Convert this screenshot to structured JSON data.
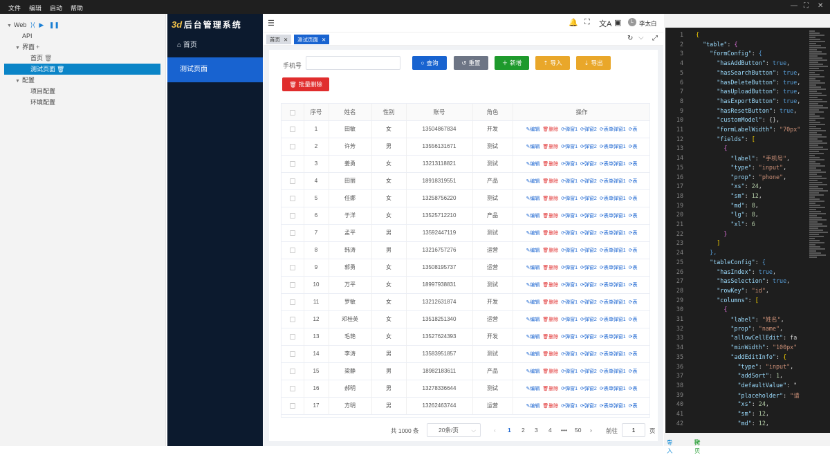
{
  "menubar": {
    "items": [
      "文件",
      "编辑",
      "启动",
      "帮助"
    ]
  },
  "tree": {
    "root": "Web",
    "api": "API",
    "ui": "界面",
    "home": "首页",
    "testpage": "测试页面",
    "config": "配置",
    "project_cfg": "项目配置",
    "env_cfg": "环境配置"
  },
  "app": {
    "logo_mark": "3d",
    "title": "后台管理系统",
    "nav": [
      "首页",
      "测试页面"
    ]
  },
  "header": {
    "user": "李太白",
    "user_initial": "L"
  },
  "tabs": [
    {
      "label": "首页"
    },
    {
      "label": "测试页面"
    }
  ],
  "form": {
    "phone_label": "手机号",
    "phone_value": "",
    "buttons": {
      "search": "查询",
      "reset": "重置",
      "add": "新增",
      "import": "导入",
      "export": "导出",
      "batch_delete": "批量删除"
    }
  },
  "colors": {
    "primary": "#1863d0",
    "gray": "#6d7585",
    "success": "#1e9a2c",
    "warning": "#e9a72a",
    "danger": "#e02d2d",
    "editor_bg": "#1e1e1e"
  },
  "table": {
    "columns": [
      "序号",
      "姓名",
      "性别",
      "账号",
      "角色",
      "操作"
    ],
    "actions": [
      "编辑",
      "删除",
      "弹窗1",
      "弹窗2",
      "表单弹窗1",
      "表"
    ],
    "rows": [
      [
        "1",
        "田敏",
        "女",
        "13504867834",
        "开发"
      ],
      [
        "2",
        "许芳",
        "男",
        "13556131671",
        "测试"
      ],
      [
        "3",
        "姜勇",
        "女",
        "13213118821",
        "测试"
      ],
      [
        "4",
        "田丽",
        "女",
        "18918319551",
        "产品"
      ],
      [
        "5",
        "任娜",
        "女",
        "13258756220",
        "测试"
      ],
      [
        "6",
        "于洋",
        "女",
        "13525712210",
        "产品"
      ],
      [
        "7",
        "孟平",
        "男",
        "13592447119",
        "测试"
      ],
      [
        "8",
        "韩涛",
        "男",
        "13216757276",
        "运营"
      ],
      [
        "9",
        "郭勇",
        "女",
        "13508195737",
        "运营"
      ],
      [
        "10",
        "万平",
        "女",
        "18997938831",
        "测试"
      ],
      [
        "11",
        "罗敏",
        "女",
        "13212631874",
        "开发"
      ],
      [
        "12",
        "邓桂英",
        "女",
        "13518251340",
        "运营"
      ],
      [
        "13",
        "毛艳",
        "女",
        "13527624393",
        "开发"
      ],
      [
        "14",
        "李涛",
        "男",
        "13583951857",
        "测试"
      ],
      [
        "15",
        "梁静",
        "男",
        "18982183611",
        "产品"
      ],
      [
        "16",
        "郝明",
        "男",
        "13278336644",
        "测试"
      ],
      [
        "17",
        "方明",
        "男",
        "13262463744",
        "运营"
      ]
    ]
  },
  "pagination": {
    "total": "共 1000 条",
    "page_size": "20条/页",
    "pages": [
      "1",
      "2",
      "3",
      "4",
      "•••",
      "50"
    ],
    "goto_label": "前往",
    "goto_value": "1",
    "page_unit": "页"
  },
  "editor": {
    "lines": [
      {
        "n": "1",
        "t": [
          [
            "p",
            "{"
          ]
        ]
      },
      {
        "n": "2",
        "t": [
          [
            "",
            "  "
          ],
          [
            "k",
            "\"table\""
          ],
          [
            "",
            ": "
          ],
          [
            "q",
            "{"
          ]
        ]
      },
      {
        "n": "3",
        "t": [
          [
            "",
            "    "
          ],
          [
            "k",
            "\"formConfig\""
          ],
          [
            "",
            ": "
          ],
          [
            "b",
            "{"
          ]
        ]
      },
      {
        "n": "4",
        "t": [
          [
            "",
            "      "
          ],
          [
            "k",
            "\"hasAddButton\""
          ],
          [
            "",
            ": "
          ],
          [
            "b",
            "true"
          ],
          [
            "",
            ","
          ]
        ]
      },
      {
        "n": "5",
        "t": [
          [
            "",
            "      "
          ],
          [
            "k",
            "\"hasSearchButton\""
          ],
          [
            "",
            ": "
          ],
          [
            "b",
            "true"
          ],
          [
            "",
            ","
          ]
        ]
      },
      {
        "n": "6",
        "t": [
          [
            "",
            "      "
          ],
          [
            "k",
            "\"hasDeleteButton\""
          ],
          [
            "",
            ": "
          ],
          [
            "b",
            "true"
          ],
          [
            "",
            ","
          ]
        ]
      },
      {
        "n": "7",
        "t": [
          [
            "",
            "      "
          ],
          [
            "k",
            "\"hasUploadButton\""
          ],
          [
            "",
            ": "
          ],
          [
            "b",
            "true"
          ],
          [
            "",
            ","
          ]
        ]
      },
      {
        "n": "8",
        "t": [
          [
            "",
            "      "
          ],
          [
            "k",
            "\"hasExportButton\""
          ],
          [
            "",
            ": "
          ],
          [
            "b",
            "true"
          ],
          [
            "",
            ","
          ]
        ]
      },
      {
        "n": "9",
        "t": [
          [
            "",
            "      "
          ],
          [
            "k",
            "\"hasResetButton\""
          ],
          [
            "",
            ": "
          ],
          [
            "b",
            "true"
          ],
          [
            "",
            ","
          ]
        ]
      },
      {
        "n": "10",
        "t": [
          [
            "",
            "      "
          ],
          [
            "k",
            "\"customModel\""
          ],
          [
            "",
            ": {},"
          ]
        ]
      },
      {
        "n": "11",
        "t": [
          [
            "",
            "      "
          ],
          [
            "k",
            "\"formLabelWidth\""
          ],
          [
            "",
            ": "
          ],
          [
            "s",
            "\"70px\""
          ]
        ]
      },
      {
        "n": "12",
        "t": [
          [
            "",
            "      "
          ],
          [
            "k",
            "\"fields\""
          ],
          [
            "",
            ": "
          ],
          [
            "p",
            "["
          ]
        ]
      },
      {
        "n": "13",
        "t": [
          [
            "",
            "        "
          ],
          [
            "q",
            "{"
          ]
        ]
      },
      {
        "n": "14",
        "t": [
          [
            "",
            "          "
          ],
          [
            "k",
            "\"label\""
          ],
          [
            "",
            ": "
          ],
          [
            "s",
            "\"手机号\""
          ],
          [
            "",
            ","
          ]
        ]
      },
      {
        "n": "15",
        "t": [
          [
            "",
            "          "
          ],
          [
            "k",
            "\"type\""
          ],
          [
            "",
            ": "
          ],
          [
            "s",
            "\"input\""
          ],
          [
            "",
            ","
          ]
        ]
      },
      {
        "n": "16",
        "t": [
          [
            "",
            "          "
          ],
          [
            "k",
            "\"prop\""
          ],
          [
            "",
            ": "
          ],
          [
            "s",
            "\"phone\""
          ],
          [
            "",
            ","
          ]
        ]
      },
      {
        "n": "17",
        "t": [
          [
            "",
            "          "
          ],
          [
            "k",
            "\"xs\""
          ],
          [
            "",
            ": "
          ],
          [
            "n",
            "24"
          ],
          [
            "",
            ","
          ]
        ]
      },
      {
        "n": "18",
        "t": [
          [
            "",
            "          "
          ],
          [
            "k",
            "\"sm\""
          ],
          [
            "",
            ": "
          ],
          [
            "n",
            "12"
          ],
          [
            "",
            ","
          ]
        ]
      },
      {
        "n": "19",
        "t": [
          [
            "",
            "          "
          ],
          [
            "k",
            "\"md\""
          ],
          [
            "",
            ": "
          ],
          [
            "n",
            "8"
          ],
          [
            "",
            ","
          ]
        ]
      },
      {
        "n": "20",
        "t": [
          [
            "",
            "          "
          ],
          [
            "k",
            "\"lg\""
          ],
          [
            "",
            ": "
          ],
          [
            "n",
            "8"
          ],
          [
            "",
            ","
          ]
        ]
      },
      {
        "n": "21",
        "t": [
          [
            "",
            "          "
          ],
          [
            "k",
            "\"xl\""
          ],
          [
            "",
            ": "
          ],
          [
            "n",
            "6"
          ]
        ]
      },
      {
        "n": "22",
        "t": [
          [
            "",
            "        "
          ],
          [
            "q",
            "}"
          ]
        ]
      },
      {
        "n": "23",
        "t": [
          [
            "",
            "      "
          ],
          [
            "p",
            "]"
          ]
        ]
      },
      {
        "n": "24",
        "t": [
          [
            "",
            "    "
          ],
          [
            "b",
            "},"
          ]
        ]
      },
      {
        "n": "25",
        "t": [
          [
            "",
            "    "
          ],
          [
            "k",
            "\"tableConfig\""
          ],
          [
            "",
            ": "
          ],
          [
            "b",
            "{"
          ]
        ]
      },
      {
        "n": "26",
        "t": [
          [
            "",
            "      "
          ],
          [
            "k",
            "\"hasIndex\""
          ],
          [
            "",
            ": "
          ],
          [
            "b",
            "true"
          ],
          [
            "",
            ","
          ]
        ]
      },
      {
        "n": "27",
        "t": [
          [
            "",
            "      "
          ],
          [
            "k",
            "\"hasSelection\""
          ],
          [
            "",
            ": "
          ],
          [
            "b",
            "true"
          ],
          [
            "",
            ","
          ]
        ]
      },
      {
        "n": "28",
        "t": [
          [
            "",
            "      "
          ],
          [
            "k",
            "\"rowKey\""
          ],
          [
            "",
            ": "
          ],
          [
            "s",
            "\"id\""
          ],
          [
            "",
            ","
          ]
        ]
      },
      {
        "n": "29",
        "t": [
          [
            "",
            "      "
          ],
          [
            "k",
            "\"columns\""
          ],
          [
            "",
            ": "
          ],
          [
            "p",
            "["
          ]
        ]
      },
      {
        "n": "30",
        "t": [
          [
            "",
            "        "
          ],
          [
            "q",
            "{"
          ]
        ]
      },
      {
        "n": "31",
        "t": [
          [
            "",
            "          "
          ],
          [
            "k",
            "\"label\""
          ],
          [
            "",
            ": "
          ],
          [
            "s",
            "\"姓名\""
          ],
          [
            "",
            ","
          ]
        ]
      },
      {
        "n": "32",
        "t": [
          [
            "",
            "          "
          ],
          [
            "k",
            "\"prop\""
          ],
          [
            "",
            ": "
          ],
          [
            "s",
            "\"name\""
          ],
          [
            "",
            ","
          ]
        ]
      },
      {
        "n": "33",
        "t": [
          [
            "",
            "          "
          ],
          [
            "k",
            "\"allowCellEdit\""
          ],
          [
            "",
            ": fa"
          ]
        ]
      },
      {
        "n": "34",
        "t": [
          [
            "",
            "          "
          ],
          [
            "k",
            "\"minWidth\""
          ],
          [
            "",
            ": "
          ],
          [
            "s",
            "\"100px\""
          ]
        ]
      },
      {
        "n": "35",
        "t": [
          [
            "",
            "          "
          ],
          [
            "k",
            "\"addEditInfo\""
          ],
          [
            "",
            ": "
          ],
          [
            "p",
            "{"
          ]
        ]
      },
      {
        "n": "36",
        "t": [
          [
            "",
            "            "
          ],
          [
            "k",
            "\"type\""
          ],
          [
            "",
            ": "
          ],
          [
            "s",
            "\"input\""
          ],
          [
            "",
            ","
          ]
        ]
      },
      {
        "n": "37",
        "t": [
          [
            "",
            "            "
          ],
          [
            "k",
            "\"addSort\""
          ],
          [
            "",
            ": "
          ],
          [
            "n",
            "1"
          ],
          [
            "",
            ","
          ]
        ]
      },
      {
        "n": "38",
        "t": [
          [
            "",
            "            "
          ],
          [
            "k",
            "\"defaultValue\""
          ],
          [
            "",
            ": \""
          ]
        ]
      },
      {
        "n": "39",
        "t": [
          [
            "",
            "            "
          ],
          [
            "k",
            "\"placeholder\""
          ],
          [
            "",
            ": "
          ],
          [
            "s",
            "\"请"
          ]
        ]
      },
      {
        "n": "40",
        "t": [
          [
            "",
            "            "
          ],
          [
            "k",
            "\"xs\""
          ],
          [
            "",
            ": "
          ],
          [
            "n",
            "24"
          ],
          [
            "",
            ","
          ]
        ]
      },
      {
        "n": "41",
        "t": [
          [
            "",
            "            "
          ],
          [
            "k",
            "\"sm\""
          ],
          [
            "",
            ": "
          ],
          [
            "n",
            "12"
          ],
          [
            "",
            ","
          ]
        ]
      },
      {
        "n": "42",
        "t": [
          [
            "",
            "            "
          ],
          [
            "k",
            "\"md\""
          ],
          [
            "",
            ": "
          ],
          [
            "n",
            "12"
          ],
          [
            "",
            ","
          ]
        ]
      }
    ]
  },
  "editor_footer": {
    "import": "导入",
    "copy": "拷贝"
  }
}
